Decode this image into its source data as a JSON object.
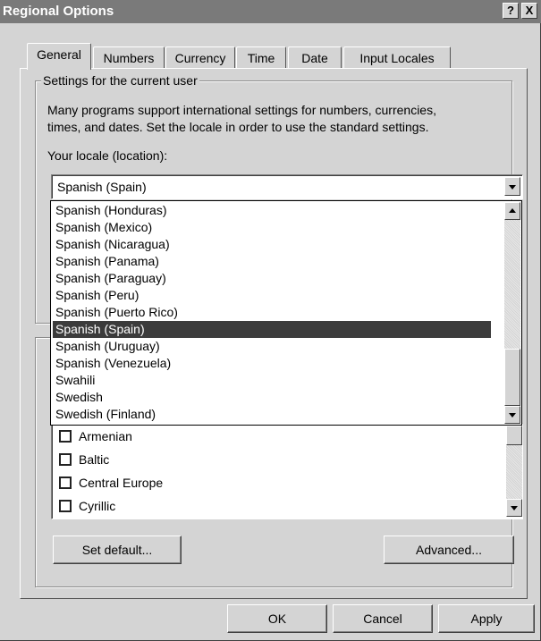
{
  "window": {
    "title": "Regional Options",
    "help_glyph": "?",
    "close_glyph": "X"
  },
  "tabs": [
    {
      "label": "General",
      "active": true
    },
    {
      "label": "Numbers",
      "active": false
    },
    {
      "label": "Currency",
      "active": false
    },
    {
      "label": "Time",
      "active": false
    },
    {
      "label": "Date",
      "active": false
    },
    {
      "label": "Input Locales",
      "active": false
    }
  ],
  "settings_group": {
    "legend": "Settings for the current user",
    "description_line1": "Many programs support international settings for numbers, currencies,",
    "description_line2": "times, and dates. Set the locale in order to use the standard settings.",
    "locale_label": "Your locale (location):",
    "locale_value": "Spanish (Spain)"
  },
  "locale_dropdown": {
    "items": [
      "Spanish (Honduras)",
      "Spanish (Mexico)",
      "Spanish (Nicaragua)",
      "Spanish (Panama)",
      "Spanish (Paraguay)",
      "Spanish (Peru)",
      "Spanish (Puerto Rico)",
      "Spanish (Spain)",
      "Spanish (Uruguay)",
      "Spanish (Venezuela)",
      "Swahili",
      "Swedish",
      "Swedish (Finland)"
    ],
    "selected": "Spanish (Spain)"
  },
  "language_settings": {
    "items": [
      {
        "label": "Armenian",
        "checked": false
      },
      {
        "label": "Baltic",
        "checked": false
      },
      {
        "label": "Central Europe",
        "checked": false
      },
      {
        "label": "Cyrillic",
        "checked": false
      }
    ]
  },
  "buttons": {
    "set_default": "Set default...",
    "advanced": "Advanced...",
    "ok": "OK",
    "cancel": "Cancel",
    "apply": "Apply"
  },
  "icons": {
    "dropdown_arrow": "chevron-down-icon",
    "scroll_up": "scroll-up-icon",
    "scroll_down": "scroll-down-icon"
  },
  "colors": {
    "title_bar": "#7a7a7a",
    "dialog_face": "#d4d4d4",
    "selection": "#3c3c3c"
  }
}
